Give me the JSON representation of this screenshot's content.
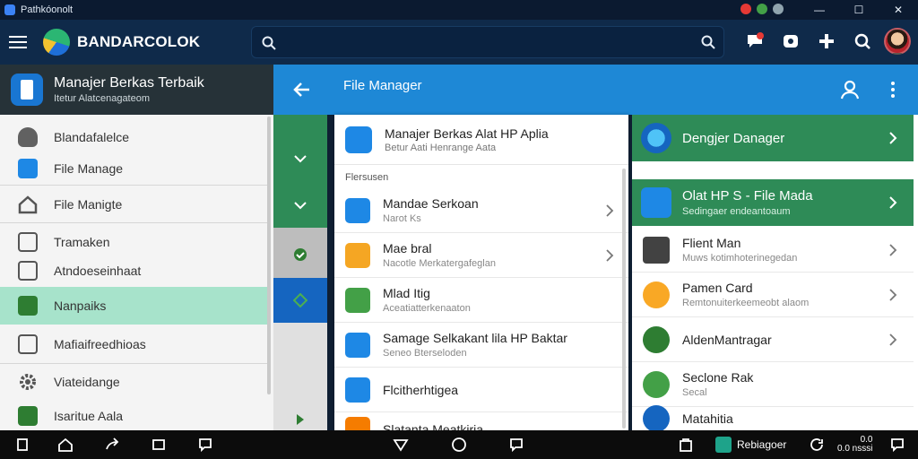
{
  "window": {
    "title": "Pathkóonolt",
    "controls": [
      "minimize",
      "maximize",
      "close"
    ]
  },
  "appbar": {
    "brand_name": "BANDARCOLOK",
    "search_placeholder": "",
    "actions": [
      "chat-icon",
      "record-icon",
      "plus-icon",
      "search-user-icon",
      "avatar"
    ]
  },
  "drawer": {
    "header_title": "Manajer Berkas Terbaik",
    "header_subtitle": "Itetur Alatcenagateom",
    "items": [
      {
        "label": "Blandafalelce",
        "icon": "shield-icon"
      },
      {
        "label": "File Manage",
        "icon": "folder-icon"
      },
      {
        "label": "File Manigte",
        "icon": "home-icon"
      },
      {
        "label": "Tramaken",
        "icon": "frame-icon"
      },
      {
        "label": "Atndoeseinhaat",
        "icon": "box-icon"
      },
      {
        "label": "Nanpaiks",
        "icon": "document-icon"
      },
      {
        "label": "Mafiaifreedhioas",
        "icon": "file-icon"
      },
      {
        "label": "Viateidange",
        "icon": "gear-icon"
      },
      {
        "label": "Isaritue Aala",
        "icon": "clipboard-icon"
      }
    ],
    "active_index": 5
  },
  "main": {
    "title": "File Manager",
    "center": {
      "header_title": "Manajer Berkas Alat HP Aplia",
      "header_subtitle": "Betur Aati Henrange Aata",
      "section_label": "Flersusen",
      "rows": [
        {
          "title": "Mandae Serkoan",
          "subtitle": "Narot Ks",
          "icon": "list-icon",
          "color": "#1e88e5"
        },
        {
          "title": "Mae bral",
          "subtitle": "Nacotle Merkatergafeglan",
          "icon": "image-icon",
          "color": "#f5a623"
        },
        {
          "title": "Mlad Itig",
          "subtitle": "Aceatiatterkenaaton",
          "icon": "message-icon",
          "color": "#43a047"
        },
        {
          "title": "Samage Selkakant lila HP Baktar",
          "subtitle": "Seneo Bterseloden",
          "icon": "storage-icon",
          "color": "#1e88e5"
        },
        {
          "title": "Flcitherhtigea",
          "subtitle": "",
          "icon": "card-icon",
          "color": "#1e88e5"
        },
        {
          "title": "Slatanta Meatkiria",
          "subtitle": "",
          "icon": "cloud-icon",
          "color": "#f57c00"
        }
      ]
    },
    "right": {
      "green_cards": [
        {
          "title": "Dengjer Danager",
          "subtitle": "",
          "icon": "globe-icon"
        },
        {
          "title": "Olat HP S - File Mada",
          "subtitle": "Sedingaer endeantoaum",
          "icon": "apps-icon"
        }
      ],
      "rows": [
        {
          "title": "Flient Man",
          "subtitle": "Muws kotimhoterinegedan",
          "icon": "terminal-icon",
          "color": "#424242"
        },
        {
          "title": "Pamen Card",
          "subtitle": "Remtonuiterkeemeobt alaom",
          "icon": "c-icon",
          "color": "#f9a825"
        },
        {
          "title": "AldenMantragar",
          "subtitle": "",
          "icon": "leaf-icon",
          "color": "#2e7d32"
        },
        {
          "title": "Seclone Rak",
          "subtitle": "Secal",
          "icon": "refresh-icon",
          "color": "#43a047"
        },
        {
          "title": "Matahitia",
          "subtitle": "",
          "icon": "chat-icon",
          "color": "#1565c0"
        }
      ]
    }
  },
  "bottombar": {
    "chip_label": "Rebiagoer",
    "clock_line1": "0.0",
    "clock_line2": "0.0 nsssi"
  },
  "colors": {
    "appbar": "#0f2a4a",
    "main_header": "#1e88d6",
    "green_card": "#2e8b57",
    "active_drawer": "#a7e3cb"
  }
}
